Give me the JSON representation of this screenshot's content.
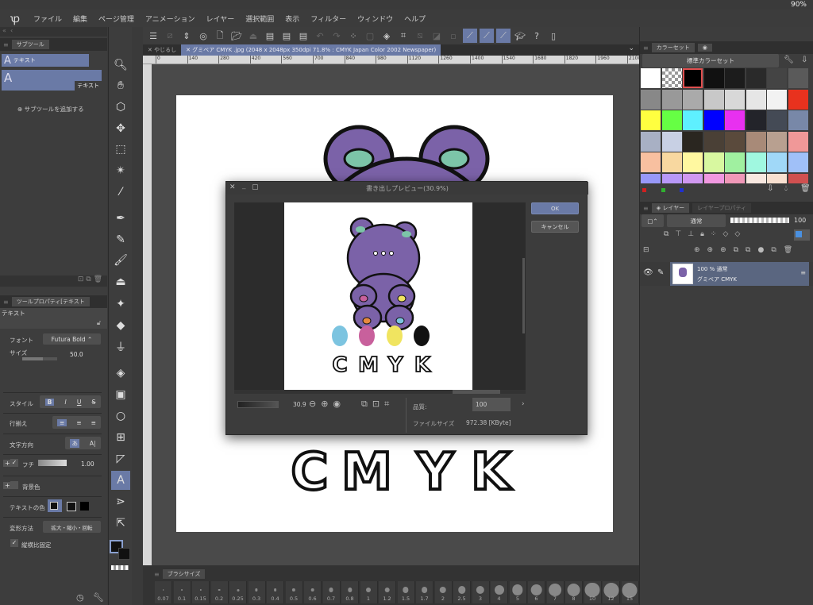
{
  "status": {
    "battery": "90%"
  },
  "menu": [
    "ファイル",
    "編集",
    "ページ管理",
    "アニメーション",
    "レイヤー",
    "選択範囲",
    "表示",
    "フィルター",
    "ウィンドウ",
    "ヘルプ"
  ],
  "subtool": {
    "tab": "サブツール",
    "group": "テキスト",
    "item": "テキスト",
    "add": "サブツールを追加する"
  },
  "toolprop": {
    "tab": "ツールプロパティ[テキスト",
    "title": "テキスト",
    "font_label": "フォント",
    "font_value": "Futura Bold",
    "size_label": "サイズ",
    "size_value": "50.0",
    "style_label": "スタイル",
    "style_buttons": [
      "B",
      "I",
      "U",
      "S"
    ],
    "align_label": "行揃え",
    "dir_label": "文字方向",
    "edge_label": "フチ",
    "edge_value": "1.00",
    "bg_label": "背景色",
    "color_label": "テキストの色",
    "transform_label": "変形方法",
    "transform_value": "拡大・縮小・回転",
    "ratio_label": "縦横比固定"
  },
  "tabs": [
    {
      "label": "やじるし",
      "active": false
    },
    {
      "label": "グミベア CMYK .jpg (2048 x 2048px 350dpi 71.8% : CMYK Japan Color 2002 Newspaper)",
      "active": true
    }
  ],
  "ruler": [
    "0",
    "140",
    "280",
    "420",
    "560",
    "700",
    "840",
    "980",
    "1120",
    "1260",
    "1400",
    "1540",
    "1680",
    "1820",
    "1960",
    "2100"
  ],
  "canvas": {
    "text": "CMYK",
    "letters": [
      "C",
      "M",
      "Y",
      "K"
    ]
  },
  "brush": {
    "tab": "ブラシサイズ",
    "sizes": [
      "0.07",
      "0.1",
      "0.15",
      "0.2",
      "0.25",
      "0.3",
      "0.4",
      "0.5",
      "0.6",
      "0.7",
      "0.8",
      "1",
      "1.2",
      "1.5",
      "1.7",
      "2",
      "2.5",
      "3",
      "4",
      "5",
      "6",
      "7",
      "8",
      "10",
      "12",
      "15"
    ]
  },
  "colorset": {
    "tab": "カラーセット",
    "name": "標準カラーセット",
    "colors": [
      "#ffffff",
      "checker",
      "#000000",
      "#111111",
      "#1c1c1c",
      "#2a2a2a",
      "#444444",
      "#5a5a5a",
      "#888888",
      "#999999",
      "#aaaaaa",
      "#c8c8c8",
      "#d8d8d8",
      "#e6e6e6",
      "#f2f2f2",
      "#e8321e",
      "#ffff40",
      "#66ff44",
      "#5ef0ff",
      "#0000ff",
      "#e830f0",
      "#23242a",
      "#444a55",
      "#7888a8",
      "#a8b0c4",
      "#c8d0e4",
      "#2a2620",
      "#4a4036",
      "#5a4a3c",
      "#a88a78",
      "#b8a090",
      "#f09898",
      "#f8c0a0",
      "#f8d8a0",
      "#fff8a0",
      "#d8f8a0",
      "#a0f0a0",
      "#a0f8e0",
      "#a0d8f8",
      "#a0c0f8",
      "#9898f8",
      "#b898f8",
      "#d098f0",
      "#f098e0",
      "#f098b8",
      "#f8e8e0",
      "#f8e0d0",
      "#d05050"
    ],
    "selected_index": 2
  },
  "layer": {
    "tab": "レイヤー",
    "tab2": "レイヤープロパティ",
    "blend": "通常",
    "opacity": "100",
    "item_info": "100 % 通常",
    "item_name": "グミベア CMYK"
  },
  "dialog": {
    "title": "書き出しプレビュー(30.9%)",
    "ok": "OK",
    "cancel": "キャンセル",
    "zoom": "30.9",
    "quality_label": "品質:",
    "quality_value": "100",
    "filesize_label": "ファイルサイズ",
    "filesize_value": "972.38 [KByte]"
  },
  "colors": {
    "accent": "#6a7aa6",
    "bear": "#7b62a8",
    "cyan": "#7cc4e0",
    "magenta": "#c8609c",
    "yellow": "#f0e460",
    "black": "#111111"
  }
}
